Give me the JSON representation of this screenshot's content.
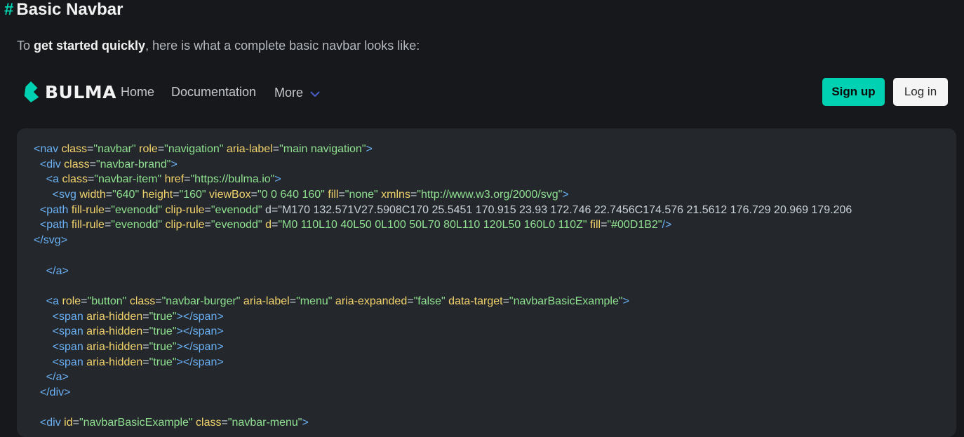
{
  "section": {
    "hash": "#",
    "title": "Basic Navbar",
    "intro_prefix": "To ",
    "intro_bold": "get started quickly",
    "intro_suffix": ", here is what a complete basic navbar looks like:"
  },
  "navbar": {
    "brand_text": "BULMA",
    "brand_color": "#00D1B2",
    "items": [
      {
        "label": "Home"
      },
      {
        "label": "Documentation"
      },
      {
        "label": "More",
        "icon": "chevron-down-icon"
      }
    ],
    "signup_label": "Sign up",
    "login_label": "Log in"
  },
  "code_lines": [
    "<nav class=\"navbar\" role=\"navigation\" aria-label=\"main navigation\">",
    "  <div class=\"navbar-brand\">",
    "    <a class=\"navbar-item\" href=\"https://bulma.io\">",
    "      <svg width=\"640\" height=\"160\" viewBox=\"0 0 640 160\" fill=\"none\" xmlns=\"http://www.w3.org/2000/svg\">",
    "  <path fill-rule=\"evenodd\" clip-rule=\"evenodd\" d=\"M170 132.571V27.5908C170 25.5451 170.915 23.93 172.746 22.7456C174.576 21.5612 176.729 20.969 179.206",
    "  <path fill-rule=\"evenodd\" clip-rule=\"evenodd\" d=\"M0 110L10 40L50 0L100 50L70 80L110 120L50 160L0 110Z\" fill=\"#00D1B2\"/>",
    "</svg>",
    "",
    "    </a>",
    "",
    "    <a role=\"button\" class=\"navbar-burger\" aria-label=\"menu\" aria-expanded=\"false\" data-target=\"navbarBasicExample\">",
    "      <span aria-hidden=\"true\"></span>",
    "      <span aria-hidden=\"true\"></span>",
    "      <span aria-hidden=\"true\"></span>",
    "      <span aria-hidden=\"true\"></span>",
    "    </a>",
    "  </div>",
    "",
    "  <div id=\"navbarBasicExample\" class=\"navbar-menu\">"
  ],
  "colors": {
    "accent": "#00D1B2",
    "background": "#16181B",
    "code_background": "#24282D",
    "code_tag": "#6AB0F3",
    "code_attr": "#F2D36B",
    "code_value": "#8FE08F"
  }
}
